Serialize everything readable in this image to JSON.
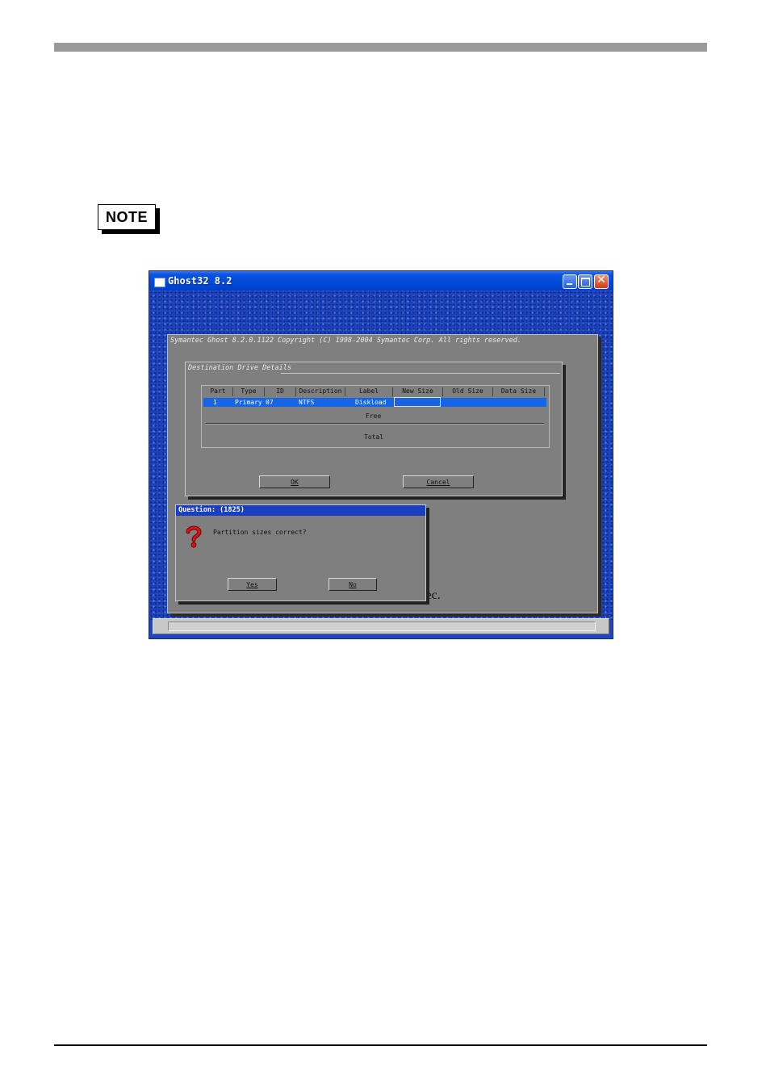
{
  "note_label": "NOTE",
  "window": {
    "title": "Ghost32 8.2"
  },
  "ghost": {
    "caption": "Symantec Ghost 8.2.0.1122   Copyright (C) 1998-2004 Symantec Corp. All rights reserved.",
    "brand_partial": "antec."
  },
  "destination_dialog": {
    "title": "Destination Drive Details",
    "columns": [
      "Part",
      "Type",
      "ID",
      "Description",
      "Label",
      "New Size",
      "Old Size",
      "Data Size"
    ],
    "row": {
      "part": "1",
      "type": "Primary",
      "id": "07",
      "description": "NTFS",
      "label": "Diskload",
      "new_size": "",
      "old_size": "",
      "data_size": ""
    },
    "free_label": "Free",
    "total_label": "Total",
    "ok_label": "OK",
    "cancel_label": "Cancel"
  },
  "question_dialog": {
    "title": "Question: (1825)",
    "message": "Partition sizes correct?",
    "yes_label": "Yes",
    "no_label": "No",
    "icon": "question-mark-icon"
  }
}
